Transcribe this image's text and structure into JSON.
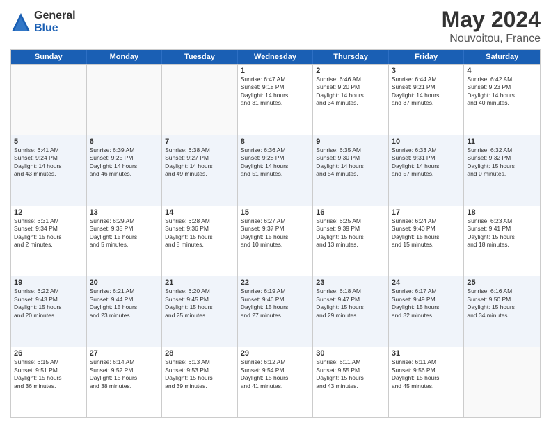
{
  "logo": {
    "general": "General",
    "blue": "Blue"
  },
  "title": "May 2024",
  "subtitle": "Nouvoitou, France",
  "header_days": [
    "Sunday",
    "Monday",
    "Tuesday",
    "Wednesday",
    "Thursday",
    "Friday",
    "Saturday"
  ],
  "rows": [
    [
      {
        "num": "",
        "info": ""
      },
      {
        "num": "",
        "info": ""
      },
      {
        "num": "",
        "info": ""
      },
      {
        "num": "1",
        "info": "Sunrise: 6:47 AM\nSunset: 9:18 PM\nDaylight: 14 hours\nand 31 minutes."
      },
      {
        "num": "2",
        "info": "Sunrise: 6:46 AM\nSunset: 9:20 PM\nDaylight: 14 hours\nand 34 minutes."
      },
      {
        "num": "3",
        "info": "Sunrise: 6:44 AM\nSunset: 9:21 PM\nDaylight: 14 hours\nand 37 minutes."
      },
      {
        "num": "4",
        "info": "Sunrise: 6:42 AM\nSunset: 9:23 PM\nDaylight: 14 hours\nand 40 minutes."
      }
    ],
    [
      {
        "num": "5",
        "info": "Sunrise: 6:41 AM\nSunset: 9:24 PM\nDaylight: 14 hours\nand 43 minutes."
      },
      {
        "num": "6",
        "info": "Sunrise: 6:39 AM\nSunset: 9:25 PM\nDaylight: 14 hours\nand 46 minutes."
      },
      {
        "num": "7",
        "info": "Sunrise: 6:38 AM\nSunset: 9:27 PM\nDaylight: 14 hours\nand 49 minutes."
      },
      {
        "num": "8",
        "info": "Sunrise: 6:36 AM\nSunset: 9:28 PM\nDaylight: 14 hours\nand 51 minutes."
      },
      {
        "num": "9",
        "info": "Sunrise: 6:35 AM\nSunset: 9:30 PM\nDaylight: 14 hours\nand 54 minutes."
      },
      {
        "num": "10",
        "info": "Sunrise: 6:33 AM\nSunset: 9:31 PM\nDaylight: 14 hours\nand 57 minutes."
      },
      {
        "num": "11",
        "info": "Sunrise: 6:32 AM\nSunset: 9:32 PM\nDaylight: 15 hours\nand 0 minutes."
      }
    ],
    [
      {
        "num": "12",
        "info": "Sunrise: 6:31 AM\nSunset: 9:34 PM\nDaylight: 15 hours\nand 2 minutes."
      },
      {
        "num": "13",
        "info": "Sunrise: 6:29 AM\nSunset: 9:35 PM\nDaylight: 15 hours\nand 5 minutes."
      },
      {
        "num": "14",
        "info": "Sunrise: 6:28 AM\nSunset: 9:36 PM\nDaylight: 15 hours\nand 8 minutes."
      },
      {
        "num": "15",
        "info": "Sunrise: 6:27 AM\nSunset: 9:37 PM\nDaylight: 15 hours\nand 10 minutes."
      },
      {
        "num": "16",
        "info": "Sunrise: 6:25 AM\nSunset: 9:39 PM\nDaylight: 15 hours\nand 13 minutes."
      },
      {
        "num": "17",
        "info": "Sunrise: 6:24 AM\nSunset: 9:40 PM\nDaylight: 15 hours\nand 15 minutes."
      },
      {
        "num": "18",
        "info": "Sunrise: 6:23 AM\nSunset: 9:41 PM\nDaylight: 15 hours\nand 18 minutes."
      }
    ],
    [
      {
        "num": "19",
        "info": "Sunrise: 6:22 AM\nSunset: 9:43 PM\nDaylight: 15 hours\nand 20 minutes."
      },
      {
        "num": "20",
        "info": "Sunrise: 6:21 AM\nSunset: 9:44 PM\nDaylight: 15 hours\nand 23 minutes."
      },
      {
        "num": "21",
        "info": "Sunrise: 6:20 AM\nSunset: 9:45 PM\nDaylight: 15 hours\nand 25 minutes."
      },
      {
        "num": "22",
        "info": "Sunrise: 6:19 AM\nSunset: 9:46 PM\nDaylight: 15 hours\nand 27 minutes."
      },
      {
        "num": "23",
        "info": "Sunrise: 6:18 AM\nSunset: 9:47 PM\nDaylight: 15 hours\nand 29 minutes."
      },
      {
        "num": "24",
        "info": "Sunrise: 6:17 AM\nSunset: 9:49 PM\nDaylight: 15 hours\nand 32 minutes."
      },
      {
        "num": "25",
        "info": "Sunrise: 6:16 AM\nSunset: 9:50 PM\nDaylight: 15 hours\nand 34 minutes."
      }
    ],
    [
      {
        "num": "26",
        "info": "Sunrise: 6:15 AM\nSunset: 9:51 PM\nDaylight: 15 hours\nand 36 minutes."
      },
      {
        "num": "27",
        "info": "Sunrise: 6:14 AM\nSunset: 9:52 PM\nDaylight: 15 hours\nand 38 minutes."
      },
      {
        "num": "28",
        "info": "Sunrise: 6:13 AM\nSunset: 9:53 PM\nDaylight: 15 hours\nand 39 minutes."
      },
      {
        "num": "29",
        "info": "Sunrise: 6:12 AM\nSunset: 9:54 PM\nDaylight: 15 hours\nand 41 minutes."
      },
      {
        "num": "30",
        "info": "Sunrise: 6:11 AM\nSunset: 9:55 PM\nDaylight: 15 hours\nand 43 minutes."
      },
      {
        "num": "31",
        "info": "Sunrise: 6:11 AM\nSunset: 9:56 PM\nDaylight: 15 hours\nand 45 minutes."
      },
      {
        "num": "",
        "info": ""
      }
    ]
  ]
}
